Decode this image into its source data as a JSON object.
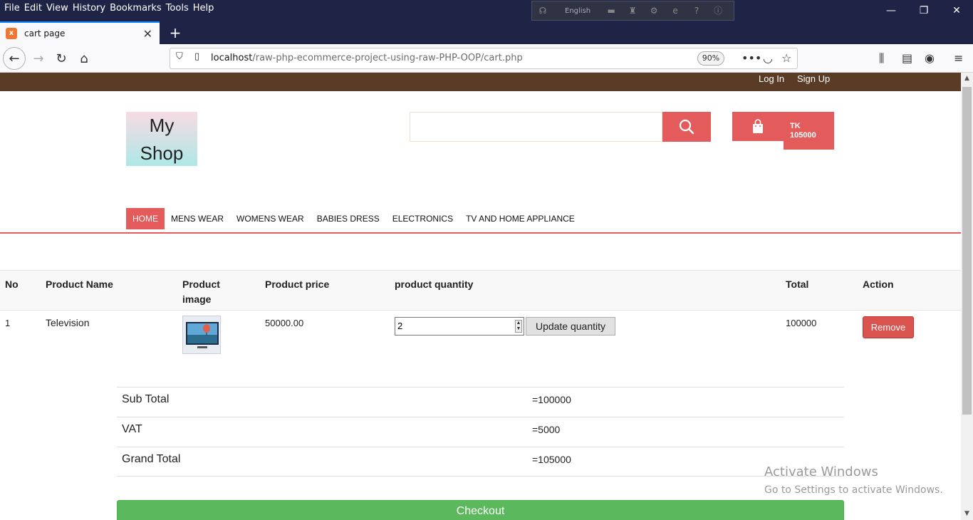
{
  "browser": {
    "menu": [
      "File",
      "Edit",
      "View",
      "History",
      "Bookmarks",
      "Tools",
      "Help"
    ],
    "toolstrip_language": "English",
    "tab_title": "cart page",
    "url_host": "localhost",
    "url_path": "/raw-php-ecommerce-project-using-raw-PHP-OOP/cart.php",
    "zoom": "90%"
  },
  "site": {
    "top_links": {
      "login": "Log In",
      "signup": "Sign Up"
    },
    "logo_line1": "My",
    "logo_line2": "Shop",
    "search_placeholder": "",
    "cart_total_currency": "TK",
    "cart_total_amount": "105000",
    "nav": [
      "HOME",
      "MENS WEAR",
      "WOMENS WEAR",
      "BABIES DRESS",
      "ELECTRONICS",
      "TV AND HOME APPLIANCE"
    ],
    "nav_active": "HOME"
  },
  "cart": {
    "headers": {
      "no": "No",
      "name": "Product Name",
      "image_l1": "Product",
      "image_l2": "image",
      "price": "Product price",
      "quantity": "product quantity",
      "total": "Total",
      "action": "Action"
    },
    "rows": [
      {
        "no": "1",
        "name": "Television",
        "image": "tv-product-icon",
        "price": "50000.00",
        "quantity": "2",
        "update_label": "Update quantity",
        "total": "100000",
        "remove_label": "Remove"
      }
    ]
  },
  "totals": {
    "subtotal_label": "Sub Total",
    "subtotal_value": "=100000",
    "vat_label": "VAT",
    "vat_value": "=5000",
    "grand_label": "Grand Total",
    "grand_value": "=105000"
  },
  "checkout_label": "Checkout",
  "watermark": {
    "line1": "Activate Windows",
    "line2": "Go to Settings to activate Windows."
  },
  "colors": {
    "accent": "#e35b5b",
    "topbar": "#5a3b26",
    "checkout": "#5cb85c",
    "remove": "#d9534f"
  }
}
